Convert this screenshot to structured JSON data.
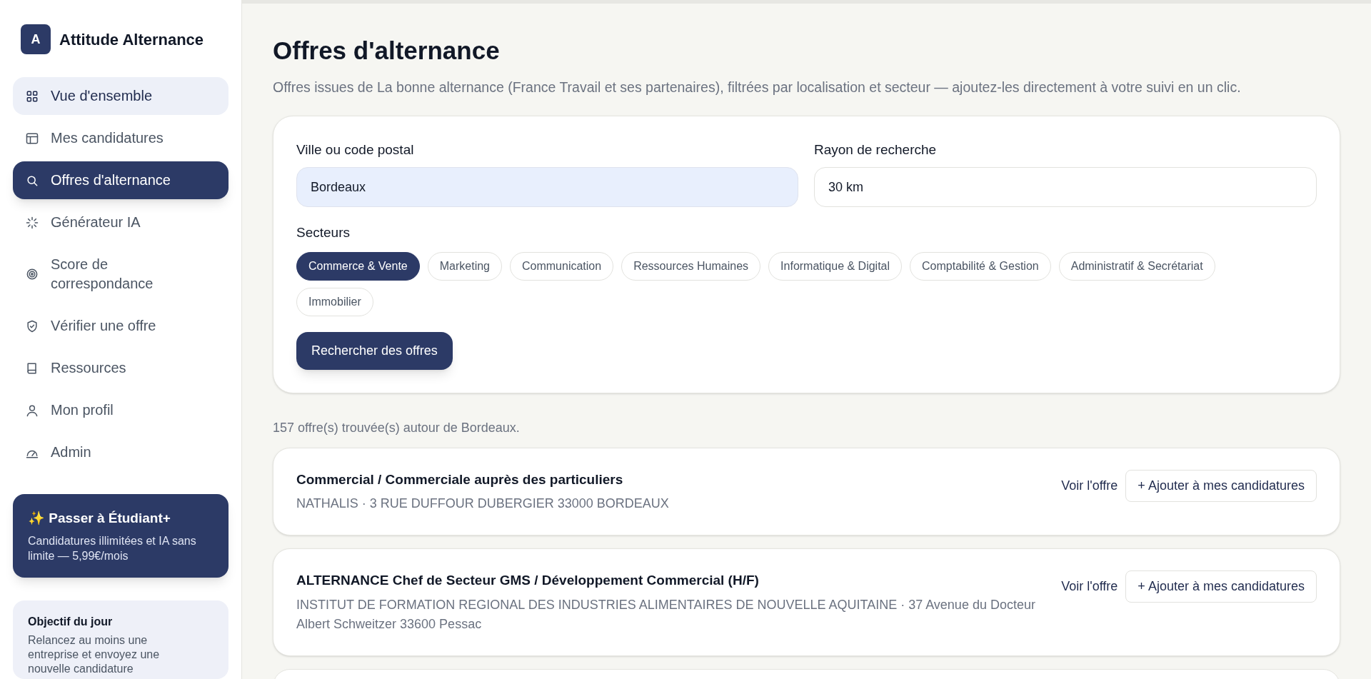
{
  "brand": {
    "logo_letter": "A",
    "name": "Attitude Alternance"
  },
  "sidebar": {
    "items": [
      {
        "label": "Vue d'ensemble",
        "selected": false,
        "hovered": true
      },
      {
        "label": "Mes candidatures",
        "selected": false,
        "hovered": false
      },
      {
        "label": "Offres d'alternance",
        "selected": true,
        "hovered": false
      },
      {
        "label": "Générateur IA",
        "selected": false,
        "hovered": false
      },
      {
        "label": "Score de correspondance",
        "selected": false,
        "hovered": false
      },
      {
        "label": "Vérifier une offre",
        "selected": false,
        "hovered": false
      },
      {
        "label": "Ressources",
        "selected": false,
        "hovered": false
      },
      {
        "label": "Mon profil",
        "selected": false,
        "hovered": false
      },
      {
        "label": "Admin",
        "selected": false,
        "hovered": false
      }
    ],
    "upgrade": {
      "title": "✨ Passer à Étudiant+",
      "text": "Candidatures illimitées et IA sans limite — 5,99€/mois"
    },
    "goal": {
      "title": "Objectif du jour",
      "text": "Relancez au moins une entreprise et envoyez une nouvelle candidature"
    }
  },
  "page": {
    "title": "Offres d'alternance",
    "subtitle": "Offres issues de La bonne alternance (France Travail et ses partenaires), filtrées par localisation et secteur — ajoutez-les directement à votre suivi en un clic."
  },
  "search": {
    "city_label": "Ville ou code postal",
    "city_value": "Bordeaux",
    "radius_label": "Rayon de recherche",
    "radius_value": "30 km",
    "sectors_label": "Secteurs",
    "sectors": [
      {
        "label": "Commerce & Vente",
        "selected": true
      },
      {
        "label": "Marketing",
        "selected": false
      },
      {
        "label": "Communication",
        "selected": false
      },
      {
        "label": "Ressources Humaines",
        "selected": false
      },
      {
        "label": "Informatique & Digital",
        "selected": false
      },
      {
        "label": "Comptabilité & Gestion",
        "selected": false
      },
      {
        "label": "Administratif & Secrétariat",
        "selected": false
      },
      {
        "label": "Immobilier",
        "selected": false
      }
    ],
    "button": "Rechercher des offres"
  },
  "results": {
    "summary": "157 offre(s) trouvée(s) autour de Bordeaux.",
    "offers": [
      {
        "title": "Commercial / Commerciale auprès des particuliers",
        "details": "NATHALIS · 3 RUE DUFFOUR DUBERGIER 33000 BORDEAUX",
        "view": "Voir l'offre",
        "add": "+ Ajouter à mes candidatures"
      },
      {
        "title": "ALTERNANCE Chef de Secteur GMS / Développement Commercial (H/F)",
        "details": "INSTITUT DE FORMATION REGIONAL DES INDUSTRIES ALIMENTAIRES DE NOUVELLE AQUITAINE · 37 Avenue du Docteur Albert Schweitzer 33600 Pessac",
        "view": "Voir l'offre",
        "add": "+ Ajouter à mes candidatures"
      }
    ]
  }
}
